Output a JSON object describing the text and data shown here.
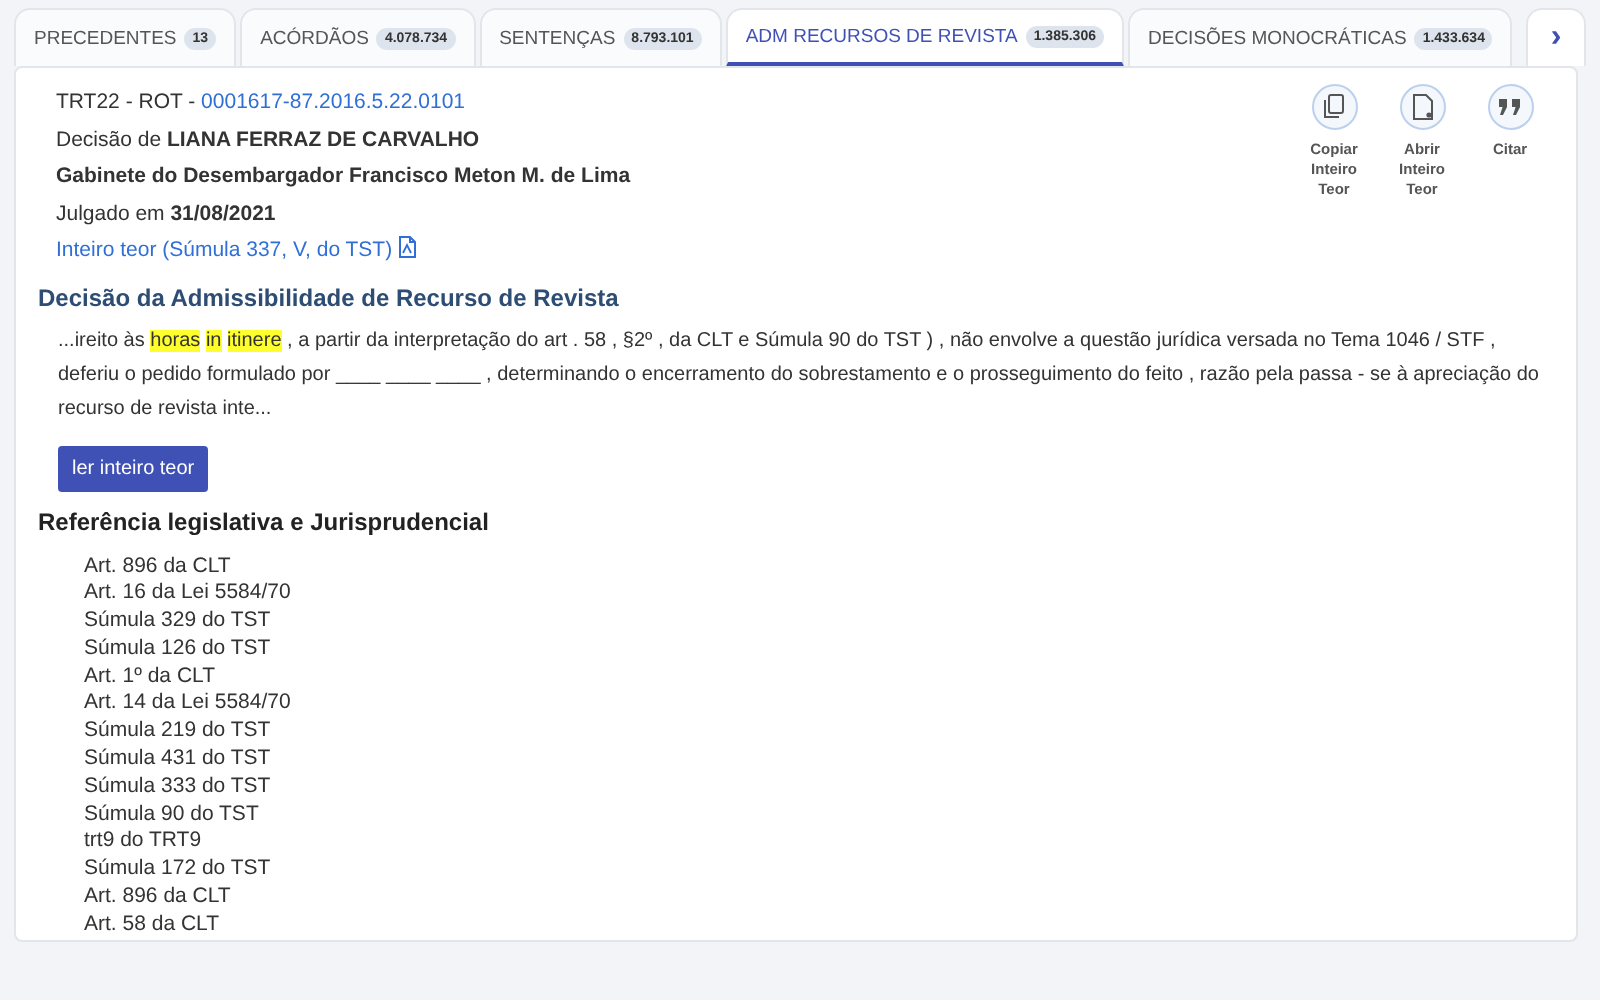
{
  "tabs": [
    {
      "label": "PRECEDENTES",
      "count": "13",
      "selected": false
    },
    {
      "label": "ACÓRDÃOS",
      "count": "4.078.734",
      "selected": false
    },
    {
      "label": "SENTENÇAS",
      "count": "8.793.101",
      "selected": false
    },
    {
      "label": "ADM RECURSOS DE REVISTA",
      "count": "1.385.306",
      "selected": true
    },
    {
      "label": "DECISÕES MONOCRÁTICAS",
      "count": "1.433.634",
      "selected": false
    }
  ],
  "tab_next": "›",
  "record": {
    "court_prefix": "TRT22 - ROT - ",
    "process_number": "0001617-87.2016.5.22.0101",
    "decision_line": "Decisão de **LIANA FERRAZ DE CARVALHO**",
    "office": "Gabinete do Desembargador Francisco Meton M. de Lima",
    "judged_line": "Julgado em **31/08/2021**",
    "full_text_link": "Inteiro teor (Súmula 337, V, do TST)"
  },
  "actions": [
    {
      "kind": "copy",
      "label": "Copiar Inteiro Teor"
    },
    {
      "kind": "open",
      "label": "Abrir Inteiro Teor"
    },
    {
      "kind": "quote",
      "label": "Citar"
    }
  ],
  "section_title": "Decisão da Admissibilidade de Recurso de Revista",
  "excerpt": [
    {
      "text": "...ireito às",
      "highlight": false
    },
    {
      "text": "horas",
      "highlight": true
    },
    {
      "text": "in",
      "highlight": true
    },
    {
      "text": "itinere",
      "highlight": true
    },
    {
      "text": ", a partir da interpretação do art . 58 , §2º , da CLT e Súmula 90 do TST ) , não envolve a questão jurídica versada no Tema 1046 / STF , deferiu o pedido formulado por ____ ____ ____ , determinando o encerramento do sobrestamento e o prosseguimento do feito , razão pela passa - se à apreciação do recurso de revista inte...",
      "highlight": false
    }
  ],
  "read_button": "ler inteiro teor",
  "references_title": "Referência legislativa e Jurisprudencial",
  "references": [
    "Art. 896 da CLT",
    "Art. 16 da Lei 5584/70",
    "Súmula 329 do TST",
    "Súmula 126 do TST",
    "Art. 1º da CLT",
    "Art. 14 da Lei 5584/70",
    "Súmula 219 do TST",
    "Súmula 431 do TST",
    "Súmula 333 do TST",
    "Súmula 90 do TST",
    "trt9 do TRT9",
    "Súmula 172 do TST",
    "Art. 896 da CLT",
    "Art. 58 da CLT"
  ]
}
